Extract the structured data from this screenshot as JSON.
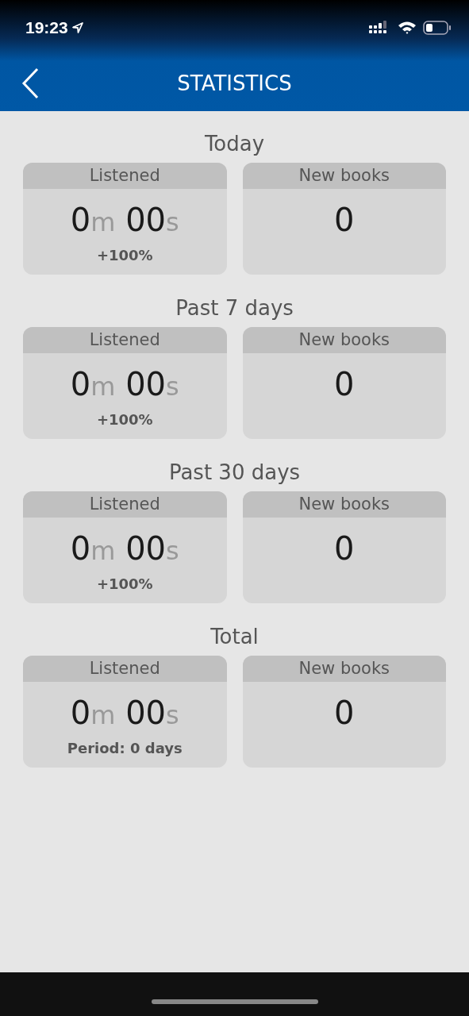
{
  "status_bar": {
    "time": "19:23"
  },
  "header": {
    "title": "STATISTICS"
  },
  "sections": [
    {
      "title": "Today",
      "listened": {
        "label": "Listened",
        "minutes": "0",
        "minutes_unit": "m",
        "seconds": "00",
        "seconds_unit": "s",
        "note": "+100%"
      },
      "new_books": {
        "label": "New books",
        "value": "0"
      }
    },
    {
      "title": "Past 7 days",
      "listened": {
        "label": "Listened",
        "minutes": "0",
        "minutes_unit": "m",
        "seconds": "00",
        "seconds_unit": "s",
        "note": "+100%"
      },
      "new_books": {
        "label": "New books",
        "value": "0"
      }
    },
    {
      "title": "Past 30 days",
      "listened": {
        "label": "Listened",
        "minutes": "0",
        "minutes_unit": "m",
        "seconds": "00",
        "seconds_unit": "s",
        "note": "+100%"
      },
      "new_books": {
        "label": "New books",
        "value": "0"
      }
    },
    {
      "title": "Total",
      "listened": {
        "label": "Listened",
        "minutes": "0",
        "minutes_unit": "m",
        "seconds": "00",
        "seconds_unit": "s",
        "note": "Period: 0 days"
      },
      "new_books": {
        "label": "New books",
        "value": "0"
      }
    }
  ]
}
